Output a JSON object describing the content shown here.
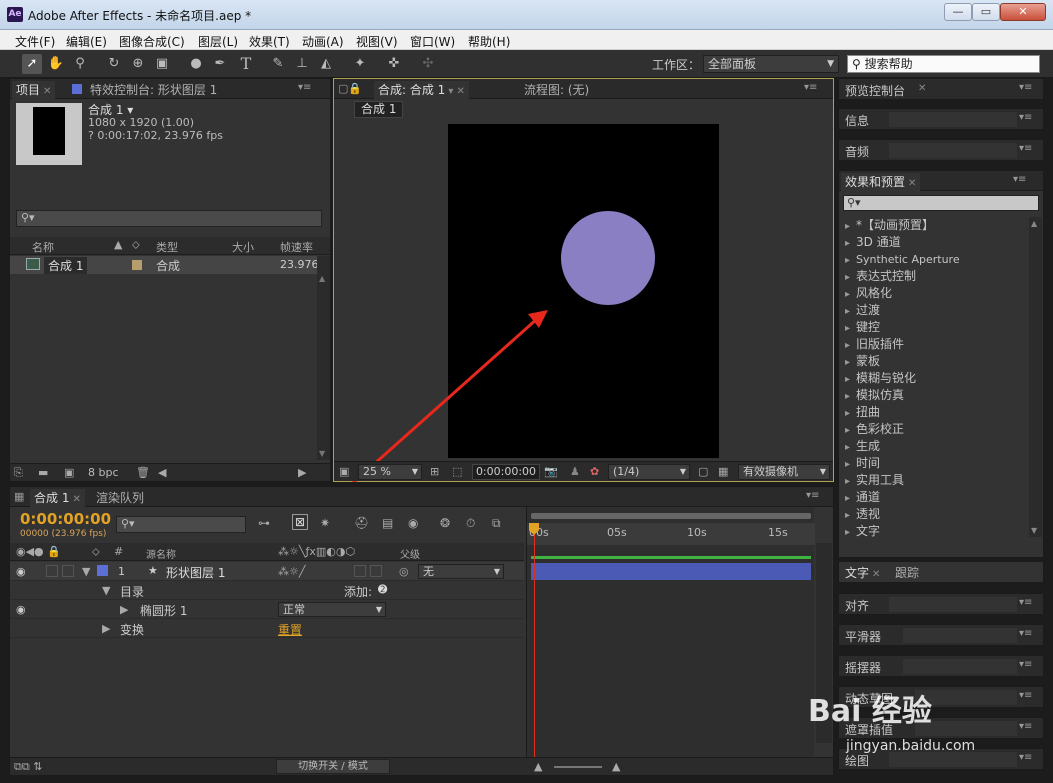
{
  "window": {
    "title": "Adobe After Effects - 未命名项目.aep *",
    "logo": "Ae",
    "buttons": [
      "—",
      "▭",
      "✕"
    ]
  },
  "menu": [
    "文件(F)",
    "编辑(E)",
    "图像合成(C)",
    "图层(L)",
    "效果(T)",
    "动画(A)",
    "视图(V)",
    "窗口(W)",
    "帮助(H)"
  ],
  "toolbar": {
    "workspace_label": "工作区：",
    "workspace_value": "全部面板",
    "help_search": "搜索帮助"
  },
  "project_panel": {
    "tabs": [
      "项目",
      "特效控制台: 形状图层 1"
    ],
    "comp_name": "合成 1 ▾",
    "comp_size": "1080 x 1920 (1.00)",
    "comp_duration": "? 0:00:17:02, 23.976 fps",
    "columns": [
      "名称",
      "类型",
      "大小",
      "帧速率"
    ],
    "items": [
      {
        "name": "合成 1",
        "type": "合成",
        "fps": "23.976"
      }
    ],
    "bpc": "8 bpc"
  },
  "composition_panel": {
    "tabs": [
      "合成: 合成 1",
      "流程图: (无)"
    ],
    "breadcrumb": "合成 1",
    "zoom": "25 %",
    "timecode": "0:00:00:00",
    "resolution": "(1/4)",
    "camera": "有效摄像机",
    "circle_color": "#8b7fc4"
  },
  "timeline": {
    "tabs": [
      "合成 1",
      "渲染队列"
    ],
    "timecode": "0:00:00:00",
    "frame_info": "00000 (23.976 fps)",
    "column_source": "源名称",
    "column_parent": "父级",
    "ruler": [
      "00s",
      "05s",
      "10s",
      "15s"
    ],
    "layers": [
      {
        "index": "1",
        "name": "形状图层 1",
        "parent": "无"
      },
      {
        "label": "目录",
        "add": "添加:"
      },
      {
        "label": "椭圆形 1",
        "mode": "正常"
      },
      {
        "label": "变换",
        "reset": "重置"
      }
    ],
    "toggle_label": "切换开关 / 模式"
  },
  "right_panels": {
    "top": [
      "预览控制台",
      "信息",
      "音频"
    ],
    "effects_title": "效果和预置",
    "effects": [
      "*【动画预置】",
      "3D 通道",
      "Synthetic Aperture",
      "表达式控制",
      "风格化",
      "过渡",
      "键控",
      "旧版插件",
      "蒙板",
      "模糊与锐化",
      "模拟仿真",
      "扭曲",
      "色彩校正",
      "生成",
      "时间",
      "实用工具",
      "通道",
      "透视",
      "文字"
    ],
    "bottom_tabs": [
      "文字",
      "跟踪"
    ],
    "bottom": [
      "对齐",
      "平滑器",
      "摇摆器",
      "动态草图",
      "遮罩插值",
      "绘图"
    ]
  },
  "watermark": {
    "text": "Bai 经验",
    "url": "jingyan.baidu.com"
  }
}
